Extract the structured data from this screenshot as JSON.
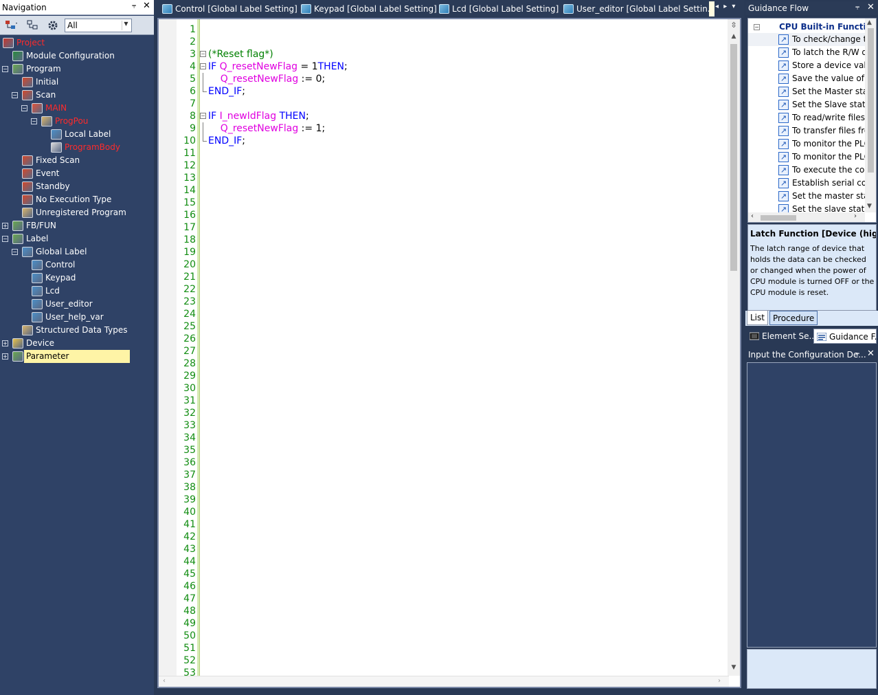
{
  "navigation": {
    "title": "Navigation",
    "pin": "⫧",
    "close": "✕",
    "filter_value": "All",
    "tree": [
      {
        "label": "Project",
        "level": 0,
        "red": true,
        "expander": "",
        "icon": "project-icon",
        "color": "#c8382e"
      },
      {
        "label": "Module Configuration",
        "level": 1,
        "expander": "",
        "icon": "module-config-icon",
        "color": "#2b8a3e"
      },
      {
        "label": "Program",
        "level": 1,
        "expander": "−",
        "icon": "program-icon",
        "color": "#6aa84f"
      },
      {
        "label": "Initial",
        "level": 2,
        "expander": "",
        "icon": "scan-icon",
        "color": "#d4482b"
      },
      {
        "label": "Scan",
        "level": 2,
        "expander": "−",
        "icon": "scan-icon",
        "color": "#d4482b"
      },
      {
        "label": "MAIN",
        "level": 3,
        "red": true,
        "expander": "−",
        "icon": "task-icon",
        "color": "#e0533a"
      },
      {
        "label": "ProgPou",
        "level": 4,
        "red": true,
        "expander": "−",
        "icon": "st-pou-icon",
        "color": "#d9b56b"
      },
      {
        "label": "Local Label",
        "level": 5,
        "expander": "",
        "icon": "local-label-icon",
        "color": "#4c8fc7"
      },
      {
        "label": "ProgramBody",
        "level": 5,
        "red": true,
        "expander": "",
        "icon": "st-body-icon",
        "color": "#d9d9d9"
      },
      {
        "label": "Fixed Scan",
        "level": 2,
        "expander": "",
        "icon": "scan-icon",
        "color": "#d4482b"
      },
      {
        "label": "Event",
        "level": 2,
        "expander": "",
        "icon": "scan-icon",
        "color": "#d4482b"
      },
      {
        "label": "Standby",
        "level": 2,
        "expander": "",
        "icon": "scan-icon",
        "color": "#d4482b"
      },
      {
        "label": "No Execution Type",
        "level": 2,
        "expander": "",
        "icon": "scan-icon",
        "color": "#d4482b"
      },
      {
        "label": "Unregistered Program",
        "level": 2,
        "expander": "",
        "icon": "unregistered-icon",
        "color": "#d9b56b"
      },
      {
        "label": "FB/FUN",
        "level": 1,
        "expander": "+",
        "icon": "fbfun-icon",
        "color": "#6aa84f"
      },
      {
        "label": "Label",
        "level": 1,
        "expander": "−",
        "icon": "label-icon",
        "color": "#6aa84f"
      },
      {
        "label": "Global Label",
        "level": 2,
        "expander": "−",
        "icon": "global-label-icon",
        "color": "#4c8fc7"
      },
      {
        "label": "Control",
        "level": 3,
        "expander": "",
        "icon": "global-label-icon",
        "color": "#4c8fc7"
      },
      {
        "label": "Keypad",
        "level": 3,
        "expander": "",
        "icon": "global-label-icon",
        "color": "#4c8fc7"
      },
      {
        "label": "Lcd",
        "level": 3,
        "expander": "",
        "icon": "global-label-icon",
        "color": "#4c8fc7"
      },
      {
        "label": "User_editor",
        "level": 3,
        "expander": "",
        "icon": "global-label-icon",
        "color": "#4c8fc7"
      },
      {
        "label": "User_help_var",
        "level": 3,
        "expander": "",
        "icon": "global-label-icon",
        "color": "#4c8fc7"
      },
      {
        "label": "Structured Data Types",
        "level": 2,
        "expander": "",
        "icon": "struct-icon",
        "color": "#d9b56b"
      },
      {
        "label": "Device",
        "level": 1,
        "expander": "+",
        "icon": "device-icon",
        "color": "#e8c24a"
      },
      {
        "label": "Parameter",
        "level": 1,
        "expander": "+",
        "icon": "parameter-icon",
        "color": "#6aa84f",
        "selected": true
      }
    ]
  },
  "tabs": [
    {
      "label": "Control [Global Label Setting]"
    },
    {
      "label": "Keypad [Global Label Setting]"
    },
    {
      "label": "Lcd [Global Label Setting]"
    },
    {
      "label": "User_editor [Global Label Settin..."
    }
  ],
  "tab_nav": "◂ ▸ ▾",
  "editor": {
    "visible_line_count": 53,
    "lines": [
      {
        "n": 1,
        "fold": "",
        "parts": []
      },
      {
        "n": 2,
        "fold": "",
        "parts": []
      },
      {
        "n": 3,
        "fold": "box",
        "parts": [
          {
            "t": "(*Reset flag*)",
            "c": "cmt"
          }
        ]
      },
      {
        "n": 4,
        "fold": "box",
        "parts": [
          {
            "t": "IF ",
            "c": "kw"
          },
          {
            "t": "Q_resetNewFlag",
            "c": "var"
          },
          {
            "t": " = 1",
            "c": ""
          },
          {
            "t": "THEN",
            "c": "kw"
          },
          {
            "t": ";",
            "c": ""
          }
        ]
      },
      {
        "n": 5,
        "fold": "line",
        "parts": [
          {
            "t": "    Q_resetNewFlag",
            "c": "var"
          },
          {
            "t": " := 0;",
            "c": ""
          }
        ]
      },
      {
        "n": 6,
        "fold": "end",
        "parts": [
          {
            "t": "END_IF",
            "c": "kw"
          },
          {
            "t": ";",
            "c": ""
          }
        ]
      },
      {
        "n": 7,
        "fold": "",
        "parts": []
      },
      {
        "n": 8,
        "fold": "box",
        "parts": [
          {
            "t": "IF ",
            "c": "kw"
          },
          {
            "t": "I_newIdFlag",
            "c": "var"
          },
          {
            "t": " ",
            "c": ""
          },
          {
            "t": "THEN",
            "c": "kw"
          },
          {
            "t": ";",
            "c": ""
          }
        ]
      },
      {
        "n": 9,
        "fold": "line",
        "parts": [
          {
            "t": "    Q_resetNewFlag",
            "c": "var"
          },
          {
            "t": " := 1;",
            "c": ""
          }
        ]
      },
      {
        "n": 10,
        "fold": "end",
        "parts": [
          {
            "t": "END_IF",
            "c": "kw"
          },
          {
            "t": ";",
            "c": ""
          }
        ]
      }
    ]
  },
  "guidance": {
    "title": "Guidance Flow",
    "category": "CPU Built-in Function",
    "items": [
      "To check/change th",
      "To latch the R/W de",
      "Store a device value",
      "Save the value of al",
      "Set the Master statio",
      "Set the Slave station",
      "To read/write files t",
      "To transfer files fror",
      "To monitor the PLC",
      "To monitor the PLC",
      "To execute the com",
      "Establish serial com",
      "Set the master statio",
      "Set the slave station"
    ],
    "desc_title": "Latch Function [Device (high spee",
    "desc_body": "The latch range of device that holds the data can be checked or changed when the power of CPU module is turned OFF or the CPU module is reset.",
    "tab_list": "List",
    "tab_procedure": "Procedure",
    "panel_tab_element": "Element Se...",
    "panel_tab_guidance": "Guidance F...",
    "config_title": "Input the Configuration De..."
  }
}
